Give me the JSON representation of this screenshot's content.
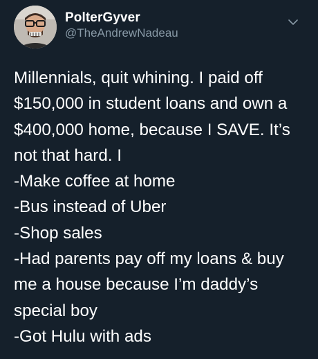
{
  "tweet": {
    "author": {
      "display_name": "PolterGyver",
      "handle": "@TheAndrewNadeau"
    },
    "icons": {
      "avatar": "user-photo-avatar",
      "more": "chevron-down-icon"
    },
    "lines": [
      "Millennials, quit whining. I paid off",
      "$150,000 in student loans and own a",
      "$400,000 home, because I SAVE. It’s",
      "not that hard. I",
      "-Make coffee at home",
      "-Bus instead of Uber",
      "-Shop sales",
      "-Had parents pay off my loans & buy",
      "me a house because I’m daddy’s",
      "special boy",
      "-Got Hulu with ads"
    ]
  },
  "colors": {
    "background": "#15202b",
    "primary_text": "#ffffff",
    "secondary_text": "#8899a6"
  }
}
